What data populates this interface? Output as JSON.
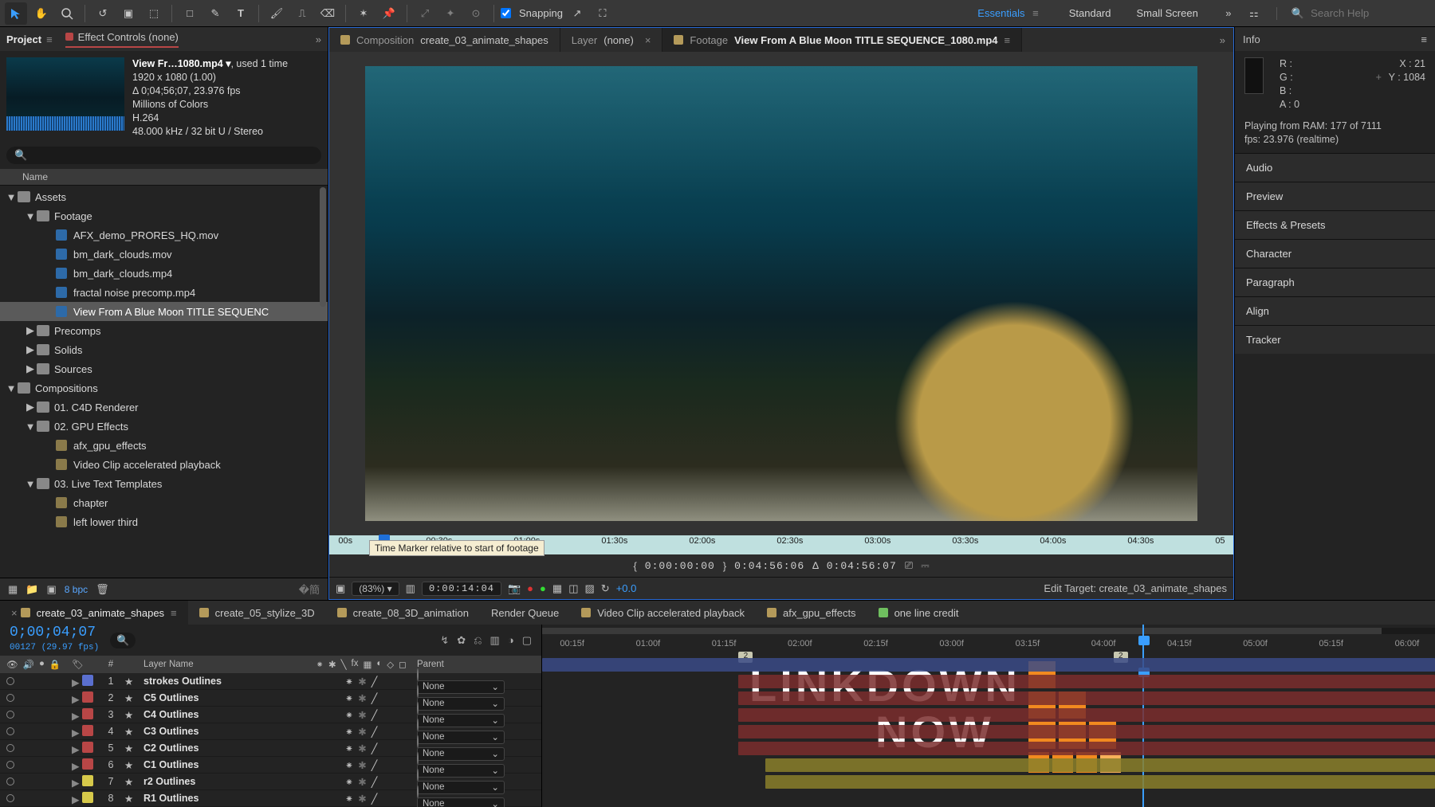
{
  "toolbar": {
    "snapping_label": "Snapping",
    "workspaces": [
      "Essentials",
      "Standard",
      "Small Screen"
    ],
    "workspace_active": 0,
    "search_placeholder": "Search Help"
  },
  "project": {
    "tab_project": "Project",
    "tab_effect_controls": "Effect Controls (none)",
    "selected_name": "View Fr…1080.mp4 ▾",
    "selected_used": ", used 1 time",
    "meta_lines": [
      "1920 x 1080 (1.00)",
      "Δ 0;04;56;07, 23.976 fps",
      "Millions of Colors",
      "H.264",
      "48.000 kHz / 32 bit U / Stereo"
    ],
    "name_header": "Name",
    "bpc": "8 bpc",
    "tree": [
      {
        "d": 0,
        "tw": "▼",
        "t": "folder",
        "l": "Assets"
      },
      {
        "d": 1,
        "tw": "▼",
        "t": "folder",
        "l": "Footage"
      },
      {
        "d": 2,
        "tw": "",
        "t": "file",
        "l": "AFX_demo_PRORES_HQ.mov"
      },
      {
        "d": 2,
        "tw": "",
        "t": "file",
        "l": "bm_dark_clouds.mov"
      },
      {
        "d": 2,
        "tw": "",
        "t": "file",
        "l": "bm_dark_clouds.mp4"
      },
      {
        "d": 2,
        "tw": "",
        "t": "file",
        "l": "fractal noise precomp.mp4"
      },
      {
        "d": 2,
        "tw": "",
        "t": "file",
        "l": "View From A Blue Moon TITLE SEQUENC",
        "sel": true
      },
      {
        "d": 1,
        "tw": "▶",
        "t": "folder",
        "l": "Precomps"
      },
      {
        "d": 1,
        "tw": "▶",
        "t": "folder",
        "l": "Solids"
      },
      {
        "d": 1,
        "tw": "▶",
        "t": "folder",
        "l": "Sources"
      },
      {
        "d": 0,
        "tw": "▼",
        "t": "folder",
        "l": "Compositions"
      },
      {
        "d": 1,
        "tw": "▶",
        "t": "folder",
        "l": "01. C4D Renderer"
      },
      {
        "d": 1,
        "tw": "▼",
        "t": "folder",
        "l": "02. GPU Effects"
      },
      {
        "d": 2,
        "tw": "",
        "t": "comp",
        "l": "afx_gpu_effects"
      },
      {
        "d": 2,
        "tw": "",
        "t": "comp",
        "l": "Video Clip accelerated playback"
      },
      {
        "d": 1,
        "tw": "▼",
        "t": "folder",
        "l": "03. Live Text Templates"
      },
      {
        "d": 2,
        "tw": "",
        "t": "comp",
        "l": "chapter"
      },
      {
        "d": 2,
        "tw": "",
        "t": "comp",
        "l": "left lower third"
      }
    ]
  },
  "viewer": {
    "tabs": [
      {
        "kind": "comp",
        "label_prefix": "Composition",
        "label": "create_03_animate_shapes",
        "color": "#b49a5a"
      },
      {
        "kind": "layer",
        "label_prefix": "Layer",
        "label": "(none)",
        "closable": true
      },
      {
        "kind": "footage",
        "label_prefix": "Footage",
        "label": "View From A Blue Moon TITLE SEQUENCE_1080.mp4",
        "color": "#b49a5a",
        "active": true,
        "menu": true
      }
    ],
    "ruler_marks": [
      "00s",
      "00:30s",
      "01:00s",
      "01:30s",
      "02:00s",
      "02:30s",
      "03:00s",
      "03:30s",
      "04:00s",
      "04:30s",
      "05"
    ],
    "tooltip": "Time Marker relative to start of footage",
    "status_in": "0:00:00:00",
    "status_out": "0:04:56:06",
    "status_dur": "Δ 0:04:56:07",
    "zoom": "(83%)",
    "displaytc": "0:00:14:04",
    "exposure": "+0.0",
    "edit_target": "Edit Target: create_03_animate_shapes"
  },
  "info": {
    "title": "Info",
    "r": "R :",
    "g": "G :",
    "b": "B :",
    "a": "A : 0",
    "x": "X : 21",
    "y": "Y : 1084",
    "ram_line": "Playing from RAM: 177 of 7111",
    "fps_line": "fps: 23.976 (realtime)",
    "panels": [
      "Audio",
      "Preview",
      "Effects & Presets",
      "Character",
      "Paragraph",
      "Align",
      "Tracker"
    ]
  },
  "timeline": {
    "tabs": [
      {
        "l": "create_03_animate_shapes",
        "c": "#b49a5a",
        "active": true,
        "closable": true,
        "menu": true
      },
      {
        "l": "create_05_stylize_3D",
        "c": "#b49a5a"
      },
      {
        "l": "create_08_3D_animation",
        "c": "#b49a5a"
      },
      {
        "l": "Render Queue"
      },
      {
        "l": "Video Clip accelerated playback",
        "c": "#b49a5a"
      },
      {
        "l": "afx_gpu_effects",
        "c": "#b49a5a"
      },
      {
        "l": "one line credit",
        "c": "#6fbf5f"
      }
    ],
    "cti": "0;00;04;07",
    "cti_sub": "00127 (29.97 fps)",
    "col_num": "#",
    "col_name": "Layer Name",
    "col_parent": "Parent",
    "ruler": [
      "00:15f",
      "01:00f",
      "01:15f",
      "02:00f",
      "02:15f",
      "03:00f",
      "03:15f",
      "04:00f",
      "04:15f",
      "05:00f",
      "05:15f",
      "06:00f"
    ],
    "marker_2": "2",
    "layers": [
      {
        "n": 1,
        "name": "strokes Outlines",
        "c": "#5a6fcf",
        "parent": "None",
        "clip": {
          "c": "#394a86",
          "l": 0,
          "r": 100
        }
      },
      {
        "n": 2,
        "name": "C5 Outlines",
        "c": "#b84646",
        "parent": "None",
        "clip": {
          "c": "#7a2d2d",
          "l": 22,
          "r": 100
        }
      },
      {
        "n": 3,
        "name": "C4 Outlines",
        "c": "#b84646",
        "parent": "None",
        "clip": {
          "c": "#7a2d2d",
          "l": 22,
          "r": 100
        }
      },
      {
        "n": 4,
        "name": "C3 Outlines",
        "c": "#b84646",
        "parent": "None",
        "clip": {
          "c": "#7a2d2d",
          "l": 22,
          "r": 100
        }
      },
      {
        "n": 5,
        "name": "C2 Outlines",
        "c": "#b84646",
        "parent": "None",
        "clip": {
          "c": "#7a2d2d",
          "l": 22,
          "r": 100
        }
      },
      {
        "n": 6,
        "name": "C1 Outlines",
        "c": "#b84646",
        "parent": "None",
        "clip": {
          "c": "#7a2d2d",
          "l": 22,
          "r": 100
        }
      },
      {
        "n": 7,
        "name": "r2 Outlines",
        "c": "#d6c94a",
        "parent": "None",
        "clip": {
          "c": "#8a7f2a",
          "l": 25,
          "r": 100
        }
      },
      {
        "n": 8,
        "name": "R1 Outlines",
        "c": "#d6c94a",
        "parent": "None",
        "clip": {
          "c": "#8a7f2a",
          "l": 25,
          "r": 100
        }
      }
    ]
  },
  "watermark": {
    "line1": "LINKDOWN",
    "line2": "NOW"
  }
}
